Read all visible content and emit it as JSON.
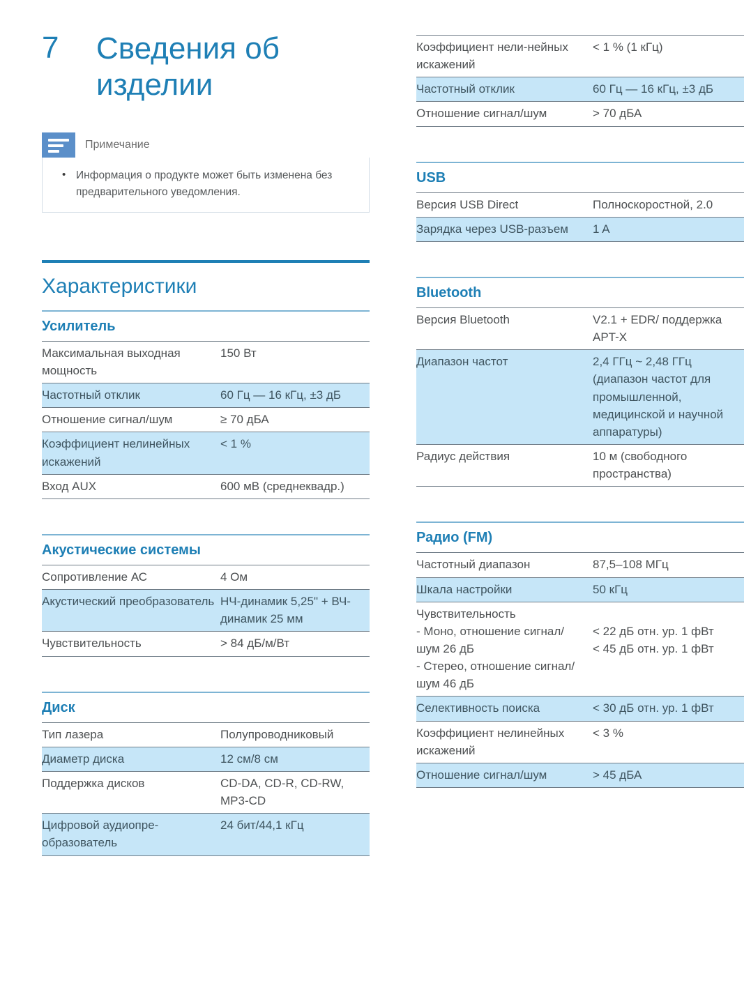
{
  "chapter": {
    "number": "7",
    "title": "Сведения об изделии"
  },
  "note": {
    "icon": "note-lines-icon",
    "label": "Примечание",
    "items": [
      "Информация о продукте может быть изменена без предварительного уведомления."
    ]
  },
  "specifications": {
    "heading": "Характеристики"
  },
  "colors": {
    "accent_blue": "#1e7fb5",
    "row_highlight": "#c6e6f8",
    "rule_gray": "#6e7b86",
    "group_rule_blue": "#7db4d4",
    "note_icon_blue": "#5b8fc9"
  },
  "groups": {
    "amplifier": {
      "heading": "Усилитель",
      "rows": [
        {
          "key": "Максимальная выходная мощность",
          "value": "150 Вт",
          "highlight": false
        },
        {
          "key": "Частотный отклик",
          "value": "60 Гц — 16 кГц, ±3 дБ",
          "highlight": true
        },
        {
          "key": "Отношение сигнал/шум",
          "value": "≥ 70 дБА",
          "highlight": false
        },
        {
          "key": "Коэффициент нелинейных искажений",
          "value": "< 1 %",
          "highlight": true
        },
        {
          "key": "Вход AUX",
          "value": "600 мВ (среднеквадр.)",
          "highlight": false
        }
      ]
    },
    "speakers": {
      "heading": "Акустические системы",
      "rows": [
        {
          "key": "Сопротивление АС",
          "value": "4 Ом",
          "highlight": false
        },
        {
          "key": "Акустический преобразователь",
          "value": "НЧ-динамик 5,25\" + ВЧ-динамик 25 мм",
          "highlight": true
        },
        {
          "key": "Чувствительность",
          "value": "> 84 дБ/м/Вт",
          "highlight": false
        }
      ]
    },
    "disc": {
      "heading": "Диск",
      "rows": [
        {
          "key": "Тип лазера",
          "value": "Полупроводниковый",
          "highlight": false
        },
        {
          "key": "Диаметр диска",
          "value": "12 см/8 см",
          "highlight": true
        },
        {
          "key": "Поддержка дисков",
          "value": "CD-DA, CD-R, CD-RW, MP3-CD",
          "highlight": false
        },
        {
          "key": "Цифровой аудиопре-образователь",
          "value": "24 бит/44,1 кГц",
          "highlight": true
        }
      ]
    },
    "continued": {
      "rows": [
        {
          "key": "Коэффициент нели-нейных искажений",
          "value": "< 1 % (1 кГц)",
          "highlight": false
        },
        {
          "key": "Частотный отклик",
          "value": "60 Гц — 16 кГц, ±3 дБ",
          "highlight": true
        },
        {
          "key": "Отношение сигнал/шум",
          "value": "> 70 дБА",
          "highlight": false
        }
      ]
    },
    "usb": {
      "heading": "USB",
      "rows": [
        {
          "key": "Версия USB Direct",
          "value": "Полноскоростной, 2.0",
          "highlight": false
        },
        {
          "key": "Зарядка через USB-разъем",
          "value": "1 A",
          "highlight": true
        }
      ]
    },
    "bluetooth": {
      "heading": "Bluetooth",
      "rows": [
        {
          "key": "Версия Bluetooth",
          "value": "V2.1 + EDR/ поддержка APT-X",
          "highlight": false
        },
        {
          "key": "Диапазон частот",
          "value": "2,4 ГГц ~ 2,48 ГГц (диапазон частот для промышленной, медицинской и научной аппаратуры)",
          "highlight": true
        },
        {
          "key": "Радиус действия",
          "value": "10 м (свободного пространства)",
          "highlight": false
        }
      ]
    },
    "radio": {
      "heading": "Радио (FM)",
      "rows": [
        {
          "key": "Частотный диапазон",
          "value": "87,5–108 МГц",
          "highlight": false
        },
        {
          "key": "Шкала настройки",
          "value": "50 кГц",
          "highlight": true
        },
        {
          "key": "Чувствительность",
          "sub_keys": [
            "- Моно, отношение сигнал/шум 26 дБ",
            "- Стерео, отношение сигнал/шум 46 дБ"
          ],
          "sub_values": [
            "< 22 дБ отн. ур. 1 фВт",
            "< 45 дБ отн. ур. 1 фВт"
          ],
          "highlight": false
        },
        {
          "key": "Селективность поиска",
          "value": "< 30 дБ отн. ур. 1 фВт",
          "highlight": true
        },
        {
          "key": "Коэффициент нелинейных искажений",
          "value": "< 3 %",
          "highlight": false
        },
        {
          "key": "Отношение сигнал/шум",
          "value": "> 45 дБА",
          "highlight": true
        }
      ]
    }
  }
}
